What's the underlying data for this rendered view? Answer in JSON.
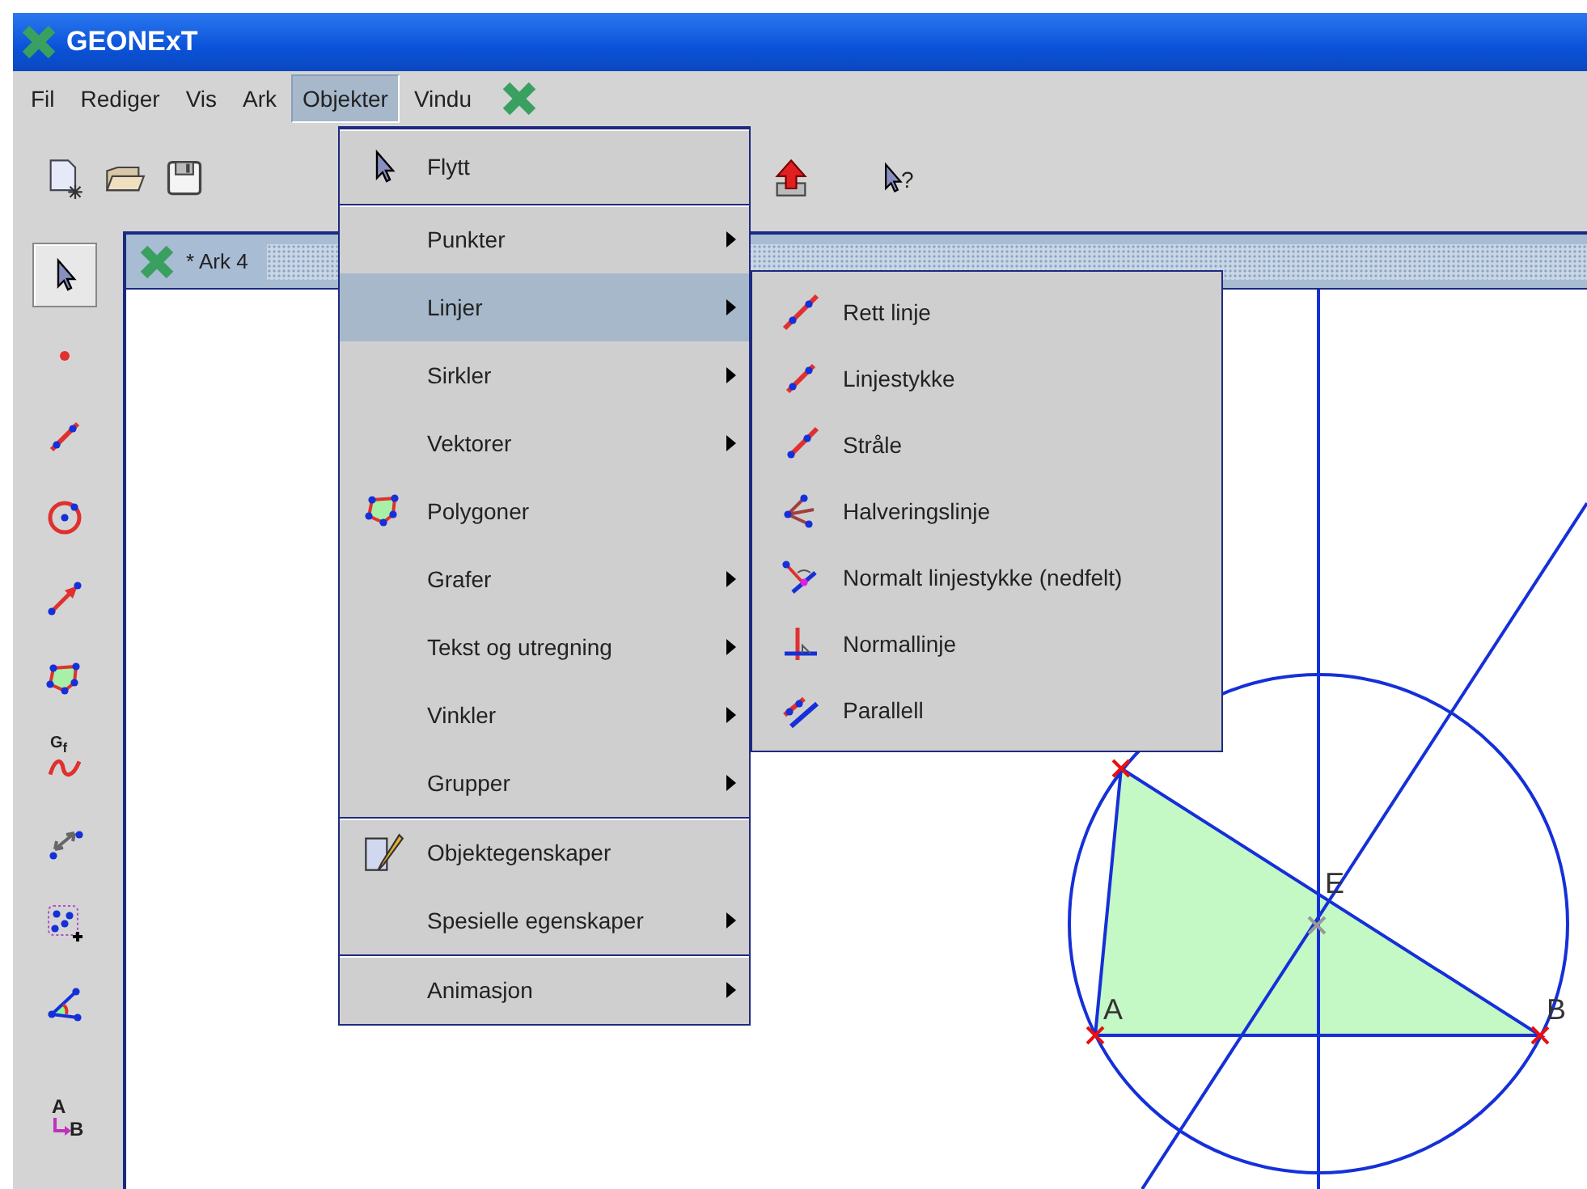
{
  "window": {
    "title": "GEONExT"
  },
  "menu_bar": [
    {
      "label": "Fil",
      "selected": false
    },
    {
      "label": "Rediger",
      "selected": false
    },
    {
      "label": "Vis",
      "selected": false
    },
    {
      "label": "Ark",
      "selected": false
    },
    {
      "label": "Objekter",
      "selected": true
    },
    {
      "label": "Vindu",
      "selected": false
    }
  ],
  "toolbar": [
    {
      "kind": "new"
    },
    {
      "kind": "open"
    },
    {
      "kind": "save"
    },
    {
      "kind": "export"
    },
    {
      "kind": "help",
      "text": "?"
    }
  ],
  "tools": [
    {
      "kind": "pointer",
      "selected": true
    },
    {
      "kind": "point",
      "selected": false
    },
    {
      "kind": "segment",
      "selected": false
    },
    {
      "kind": "circle",
      "selected": false
    },
    {
      "kind": "vector",
      "selected": false
    },
    {
      "kind": "polygon",
      "selected": false
    },
    {
      "kind": "graph",
      "selected": false,
      "text": "G$_{f}$"
    },
    {
      "kind": "distance",
      "selected": false
    },
    {
      "kind": "group",
      "selected": false
    },
    {
      "kind": "angle",
      "selected": false
    },
    {
      "kind": "label",
      "selected": false,
      "text": "A",
      "text_2": "B"
    }
  ],
  "document": {
    "title": "* Ark 4",
    "labels": [
      "A",
      "B",
      "E"
    ]
  },
  "menu": {
    "groups": [
      [
        {
          "label": "Flytt",
          "kind": "cursor",
          "submenu": false,
          "selected": false
        }
      ],
      [
        {
          "label": "Punkter",
          "submenu": true,
          "selected": false
        },
        {
          "label": "Linjer",
          "submenu": true,
          "selected": true
        },
        {
          "label": "Sirkler",
          "submenu": true,
          "selected": false
        },
        {
          "label": "Vektorer",
          "submenu": true,
          "selected": false
        },
        {
          "label": "Polygoner",
          "kind": "polygon",
          "submenu": false,
          "selected": false
        },
        {
          "label": "Grafer",
          "submenu": true,
          "selected": false
        },
        {
          "label": "Tekst og utregning",
          "submenu": true,
          "selected": false
        },
        {
          "label": "Vinkler",
          "submenu": true,
          "selected": false
        },
        {
          "label": "Grupper",
          "submenu": true,
          "selected": false
        }
      ],
      [
        {
          "label": "Objektegenskaper",
          "kind": "properties",
          "submenu": false,
          "selected": false
        },
        {
          "label": "Spesielle egenskaper",
          "submenu": true,
          "selected": false
        }
      ],
      [
        {
          "label": "Animasjon",
          "submenu": true,
          "selected": false
        }
      ]
    ]
  },
  "submenu": {
    "items": [
      {
        "label": "Rett linje",
        "kind": "line"
      },
      {
        "label": "Linjestykke",
        "kind": "segment"
      },
      {
        "label": "Stråle",
        "kind": "ray"
      },
      {
        "label": "Halveringslinje",
        "kind": "bisector"
      },
      {
        "label": "Normalt linjestykke (nedfelt)",
        "kind": "perpendicular-segment"
      },
      {
        "label": "Normallinje",
        "kind": "normal"
      },
      {
        "label": "Parallell",
        "kind": "parallel"
      }
    ]
  }
}
